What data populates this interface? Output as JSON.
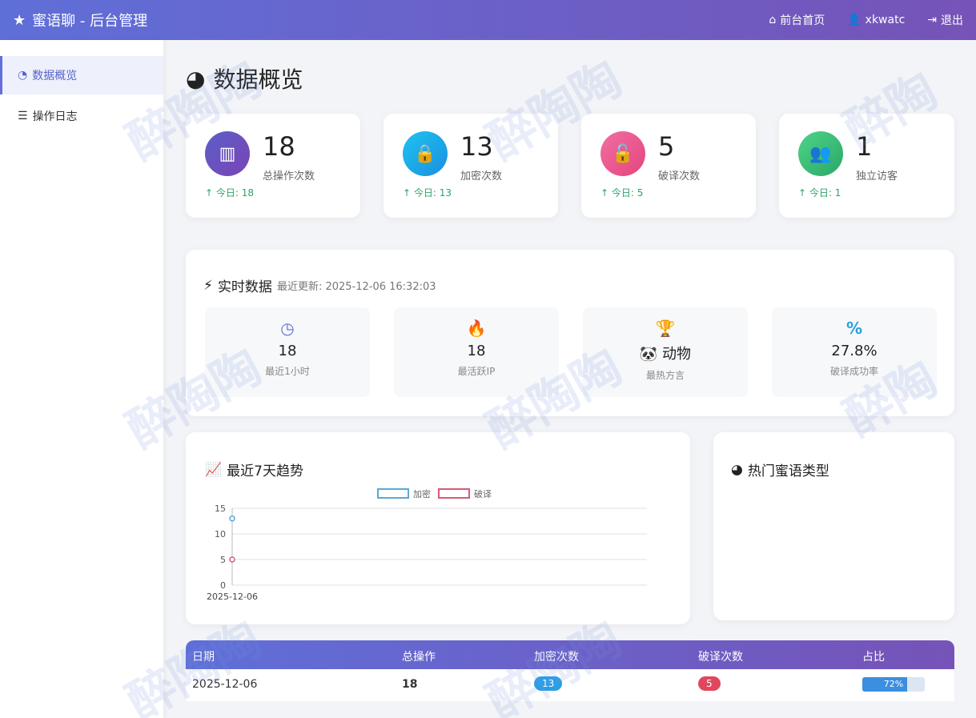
{
  "header": {
    "title": "蜜语聊 - 后台管理",
    "nav": [
      "前台首页",
      "xkwatc",
      "退出"
    ]
  },
  "sidebar": {
    "items": [
      {
        "label": "数据概览",
        "active": true
      },
      {
        "label": "操作日志",
        "active": false
      }
    ]
  },
  "page": {
    "title": "数据概览"
  },
  "stats": [
    {
      "value": "18",
      "label": "总操作次数",
      "today": "今日: 18",
      "color": "#6c4fc2",
      "icon": "bar-chart-icon"
    },
    {
      "value": "13",
      "label": "加密次数",
      "today": "今日: 13",
      "color": "#21b3e8",
      "icon": "lock-icon"
    },
    {
      "value": "5",
      "label": "破译次数",
      "today": "今日: 5",
      "color": "#ec5a8e",
      "icon": "unlock-icon"
    },
    {
      "value": "1",
      "label": "独立访客",
      "today": "今日: 1",
      "color": "#3bc47a",
      "icon": "users-icon"
    }
  ],
  "realtime": {
    "title": "实时数据",
    "updated": "最近更新: 2025-12-06 16:32:03",
    "items": [
      {
        "value": "18",
        "label": "最近1小时",
        "icon": "clock-icon"
      },
      {
        "value": "18",
        "label": "最活跃IP",
        "icon": "fire-icon"
      },
      {
        "value": "🐼 动物",
        "label": "最热方言",
        "icon": "trophy-icon"
      },
      {
        "value": "27.8%",
        "label": "破译成功率",
        "icon": "percent-icon"
      }
    ]
  },
  "trend": {
    "title": "最近7天趋势"
  },
  "hot": {
    "title": "热门蜜语类型"
  },
  "chart_data": {
    "type": "line",
    "x": [
      "2025-12-06"
    ],
    "series": [
      {
        "name": "加密",
        "values": [
          13
        ],
        "color": "#5aa9d6"
      },
      {
        "name": "破译",
        "values": [
          5
        ],
        "color": "#d65a76"
      }
    ],
    "ylim": [
      0,
      15
    ],
    "yticks": [
      "0",
      "5",
      "10",
      "15"
    ],
    "grid": true,
    "legend": "top-center"
  },
  "table": {
    "headers": [
      "日期",
      "总操作",
      "加密次数",
      "破译次数",
      "占比"
    ],
    "rows": [
      {
        "date": "2025-12-06",
        "total": "18",
        "encrypt": "13",
        "decrypt": "5",
        "ratio": "72%",
        "ratio_value": 0.72
      }
    ]
  }
}
